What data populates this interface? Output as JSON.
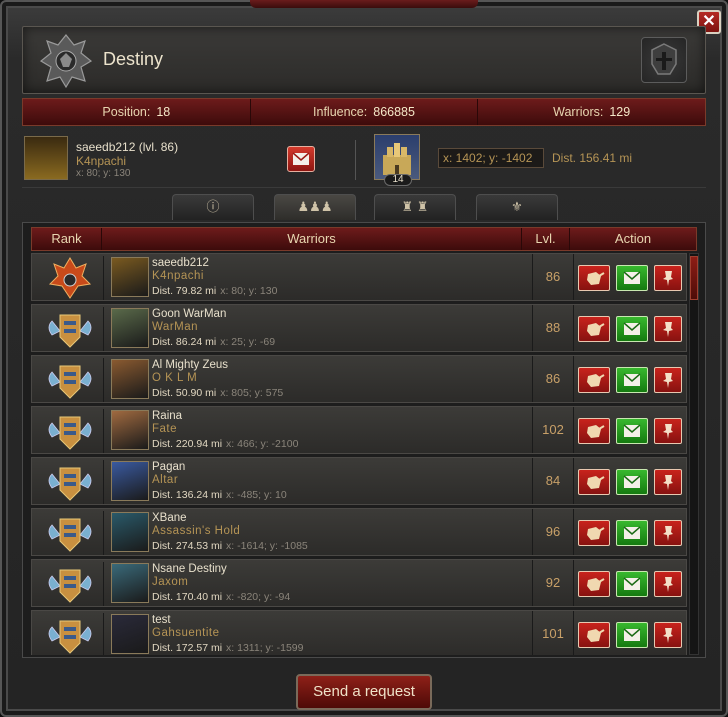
{
  "window": {
    "close_label": "✕"
  },
  "header": {
    "title": "Destiny"
  },
  "stats": {
    "position_label": "Position:",
    "position_value": "18",
    "influence_label": "Influence:",
    "influence_value": "866885",
    "warriors_label": "Warriors:",
    "warriors_value": "129"
  },
  "user": {
    "name": "saeedb212 (lvl. 86)",
    "guild": "K4npachi",
    "coords": "x: 80; y: 130",
    "castle_level": "14",
    "coord_box": "x: 1402; y: -1402",
    "distance": "Dist. 156.41 mi"
  },
  "tabs": [
    {
      "label": "ⓘ",
      "icon": "info-icon"
    },
    {
      "label": "♟♟♟",
      "icon": "members-icon"
    },
    {
      "label": "♜ ♜",
      "icon": "buildings-icon"
    },
    {
      "label": "⚜",
      "icon": "wings-helm-icon"
    }
  ],
  "table": {
    "headers": {
      "rank": "Rank",
      "warriors": "Warriors",
      "level": "Lvl.",
      "action": "Action"
    },
    "rows": [
      {
        "name": "saeedb212",
        "guild": "K4npachi",
        "dist": "Dist. 79.82 mi",
        "xy": "x: 80; y: 130",
        "level": "86",
        "rank": "leader",
        "avatar_color": "#7a5a20"
      },
      {
        "name": "Goon WarMan",
        "guild": "WarMan",
        "dist": "Dist. 86.24 mi",
        "xy": "x: 25; y: -69",
        "level": "88",
        "rank": "member",
        "avatar_color": "#5a6a4a"
      },
      {
        "name": "Al Mighty Zeus",
        "guild": "O K L M",
        "dist": "Dist. 50.90 mi",
        "xy": "x: 805; y: 575",
        "level": "86",
        "rank": "member",
        "avatar_color": "#8a5a30"
      },
      {
        "name": "Raina",
        "guild": "Fate",
        "dist": "Dist. 220.94 mi",
        "xy": "x: 466; y: -2100",
        "level": "102",
        "rank": "member",
        "avatar_color": "#a06a40"
      },
      {
        "name": "Pagan",
        "guild": "Altar",
        "dist": "Dist. 136.24 mi",
        "xy": "x: -485; y: 10",
        "level": "84",
        "rank": "member",
        "avatar_color": "#3a5aa0"
      },
      {
        "name": "XBane",
        "guild": "Assassin's Hold",
        "dist": "Dist. 274.53 mi",
        "xy": "x: -1614; y: -1085",
        "level": "96",
        "rank": "member",
        "avatar_color": "#2a5a6a"
      },
      {
        "name": "Nsane Destiny",
        "guild": "Jaxom",
        "dist": "Dist. 170.40 mi",
        "xy": "x: -820; y: -94",
        "level": "92",
        "rank": "member",
        "avatar_color": "#3a6a7a"
      },
      {
        "name": "test",
        "guild": "Gahsuentite",
        "dist": "Dist. 172.57 mi",
        "xy": "x: 1311; y: -1599",
        "level": "101",
        "rank": "member",
        "avatar_color": "#2a2a3a"
      }
    ]
  },
  "footer": {
    "send_request_label": "Send a request"
  },
  "colors": {
    "accent_red": "#7a1a16",
    "action_green": "#2a9a22",
    "guild_gold": "#b59455"
  }
}
